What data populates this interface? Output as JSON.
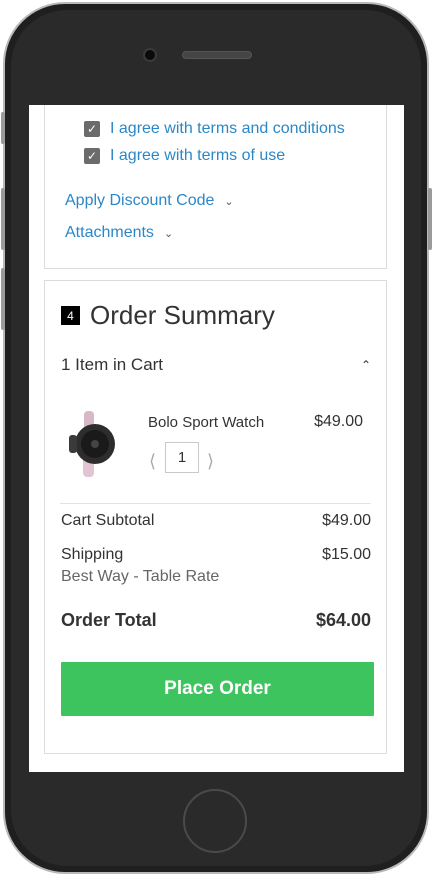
{
  "checkout": {
    "agreements": [
      {
        "label": "I agree with terms and conditions",
        "checked": true
      },
      {
        "label": "I agree with terms of use",
        "checked": true
      }
    ],
    "discount_label": "Apply Discount Code",
    "attachments_label": "Attachments"
  },
  "summary": {
    "step_number": "4",
    "title": "Order Summary",
    "cart_count_label": "1 Item in Cart",
    "item": {
      "name": "Bolo Sport Watch",
      "price": "$49.00",
      "quantity": "1"
    },
    "subtotal_label": "Cart Subtotal",
    "subtotal_value": "$49.00",
    "shipping_label": "Shipping",
    "shipping_value": "$15.00",
    "shipping_method": "Best Way - Table Rate",
    "total_label": "Order Total",
    "total_value": "$64.00",
    "place_order_label": "Place Order"
  },
  "icons": {
    "checkbox": "check-icon",
    "collapse": "chevron-down-icon",
    "expand": "chevron-up-icon",
    "qty_minus": "chevron-left-icon",
    "qty_plus": "chevron-right-icon"
  },
  "colors": {
    "link": "#2b87c8",
    "place_order_button": "#3ec45e",
    "step_badge": "#000000"
  }
}
